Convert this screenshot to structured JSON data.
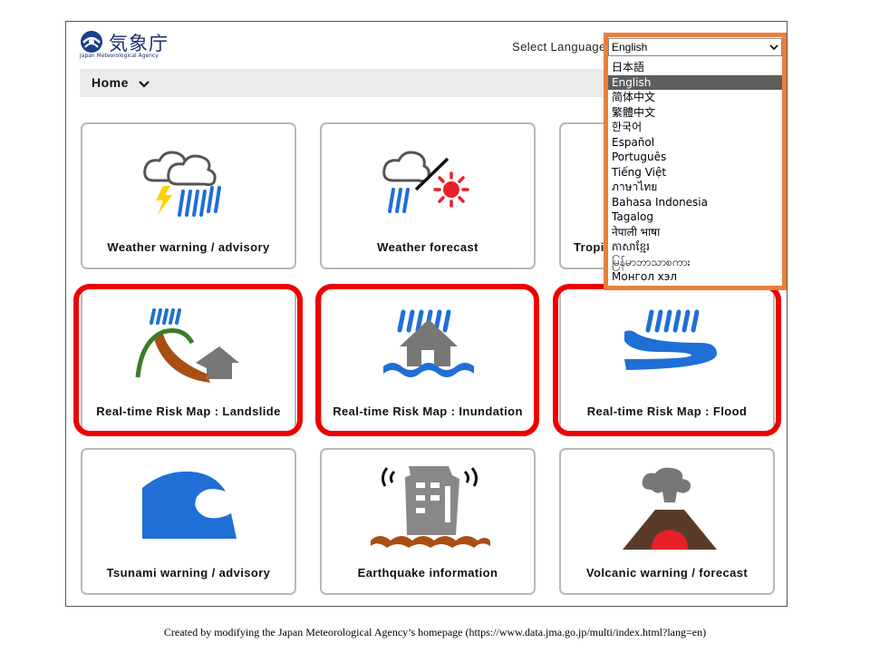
{
  "header": {
    "logo_text": "気象庁",
    "logo_subtext": "Japan Meteorological Agency",
    "language_label": "Select Language",
    "language_selected": "English"
  },
  "nav": {
    "home_label": "Home"
  },
  "language_options": [
    "日本語",
    "English",
    "简体中文",
    "繁體中文",
    "한국어",
    "Español",
    "Português",
    "Tiếng Việt",
    "ภาษาไทย",
    "Bahasa Indonesia",
    "Tagalog",
    "नेपाली भाषा",
    "ភាសាខ្មែរ",
    "မြန်မာဘာသာစကား",
    "Монгол хэл"
  ],
  "cards": [
    {
      "label": "Weather warning / advisory",
      "icon": "thunderstorm-icon"
    },
    {
      "label": "Weather forecast",
      "icon": "rain-sun-icon"
    },
    {
      "label": "Tropi",
      "icon": "typhoon-icon"
    },
    {
      "label": "Real-time Risk Map : Landslide",
      "icon": "landslide-icon"
    },
    {
      "label": "Real-time Risk Map : Inundation",
      "icon": "inundation-icon"
    },
    {
      "label": "Real-time Risk Map : Flood",
      "icon": "flood-icon"
    },
    {
      "label": "Tsunami warning / advisory",
      "icon": "tsunami-icon"
    },
    {
      "label": "Earthquake information",
      "icon": "earthquake-icon"
    },
    {
      "label": "Volcanic warning / forecast",
      "icon": "volcano-icon"
    }
  ],
  "caption": "Created by modifying the Japan Meteorological Agency’s homepage (https://www.data.jma.go.jp/multi/index.html?lang=en)",
  "colors": {
    "highlight_red": "#ee0000",
    "highlight_orange": "#e9803a",
    "rain_blue": "#1f6fd6",
    "navbar_gray": "#ebebeb"
  }
}
